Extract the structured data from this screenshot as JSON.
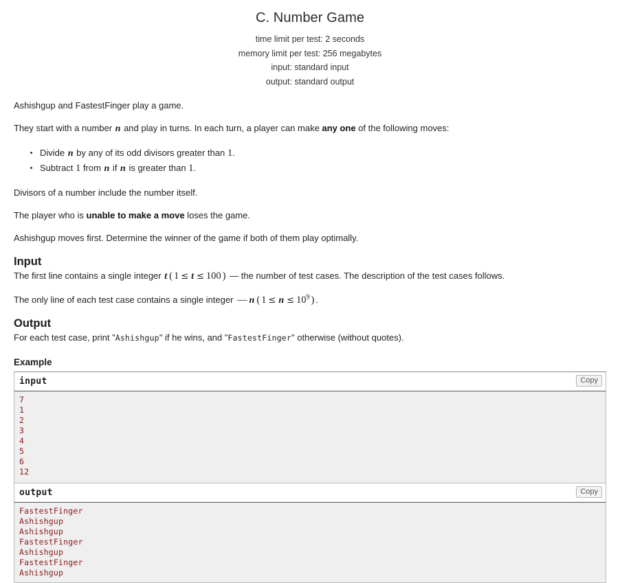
{
  "header": {
    "title": "C. Number Game",
    "time_limit": "time limit per test: 2 seconds",
    "memory_limit": "memory limit per test: 256 megabytes",
    "input_spec": "input: standard input",
    "output_spec": "output: standard output"
  },
  "legend": {
    "p1": "Ashishgup and FastestFinger play a game.",
    "p2_a": "They start with a number ",
    "p2_n": "n",
    "p2_b": " and play in turns. In each turn, a player can make ",
    "p2_bold": "any one",
    "p2_c": " of the following moves:",
    "bullets": [
      {
        "a": "Divide ",
        "n": "n",
        "b": " by any of its odd divisors greater than ",
        "num": "1",
        "c": "."
      },
      {
        "a": "Subtract ",
        "num1": "1",
        "b": " from ",
        "n1": "n",
        "c": " if ",
        "n2": "n",
        "d": " is greater than ",
        "num2": "1",
        "e": "."
      }
    ],
    "p3": "Divisors of a number include the number itself.",
    "p4_a": "The player who is ",
    "p4_bold": "unable to make a move",
    "p4_b": " loses the game.",
    "p5": "Ashishgup moves first. Determine the winner of the game if both of them play optimally."
  },
  "input_section": {
    "title": "Input",
    "p1_a": "The first line contains a single integer ",
    "p1_t": "t",
    "p1_paren_open": "(",
    "p1_one": "1",
    "p1_le1": "≤",
    "p1_t2": "t",
    "p1_le2": "≤",
    "p1_hundred": "100",
    "p1_paren_close": ")",
    "p1_b": " — the number of test cases. The description of the test cases follows.",
    "p2_a": "The only line of each test case contains a single integer ",
    "p2_dash": "—",
    "p2_n": "n",
    "p2_paren_open": "(",
    "p2_one": "1",
    "p2_le1": "≤",
    "p2_n2": "n",
    "p2_le2": "≤",
    "p2_ten": "10",
    "p2_exp": "9",
    "p2_paren_close": ")",
    "p2_b": "."
  },
  "output_section": {
    "title": "Output",
    "p1_a": "For each test case, print \"",
    "p1_name1": "Ashishgup",
    "p1_b": "\" if he wins, and \"",
    "p1_name2": "FastestFinger",
    "p1_c": "\" otherwise (without quotes)."
  },
  "example": {
    "title": "Example",
    "input_label": "input",
    "output_label": "output",
    "copy_label": "Copy",
    "input_text": "7\n1\n2\n3\n4\n5\n6\n12",
    "output_text": "FastestFinger\nAshishgup\nAshishgup\nFastestFinger\nAshishgup\nFastestFinger\nAshishgup"
  },
  "colors": {
    "sample_text": "#8b1a1a",
    "sample_bg": "#efefef",
    "border": "#bbbbbb"
  }
}
